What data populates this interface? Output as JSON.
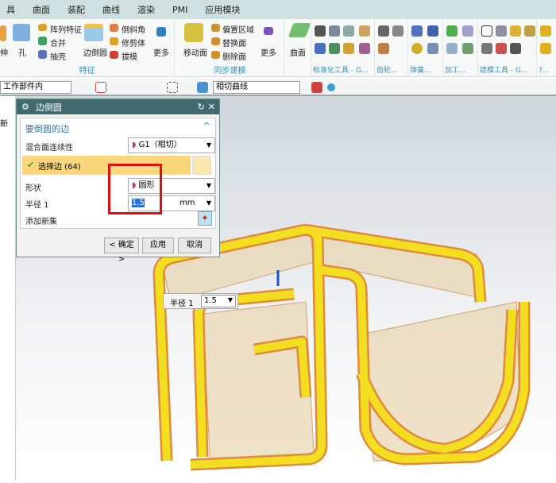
{
  "menu": [
    "具",
    "曲面",
    "装配",
    "曲线",
    "渲染",
    "PMI",
    "应用模块"
  ],
  "ribbon": {
    "feature": {
      "left_cut": "伸",
      "hole": "孔",
      "pattern": "阵列特征",
      "combine": "合并",
      "shell": "抽壳",
      "edge_blend": "边倒圆",
      "chamfer": "倒斜角",
      "trim_body": "修剪体",
      "draft": "拔模",
      "more": "更多",
      "label": "特征"
    },
    "sync": {
      "move_face": "移动面",
      "offset_region": "偏置区域",
      "replace_face": "替换面",
      "delete_face": "删除面",
      "more": "更多",
      "label": "同步建模"
    },
    "surface": {
      "label": "曲面"
    },
    "groups": [
      "标准化工具 - G...",
      "齿轮...",
      "弹簧...",
      "加工...",
      "建模工具 - G...",
      "?..."
    ]
  },
  "toolbar": {
    "scope": "工作部件内",
    "curve_rule": "相切曲线"
  },
  "left_panel": {
    "tab": "新"
  },
  "dialog": {
    "title": "边倒圆",
    "section": "要倒圆的边",
    "continuity_label": "混合面连续性",
    "continuity_value": "G1（相切）",
    "select_edge": "选择边 (64)",
    "shape_label": "形状",
    "shape_value": "圆形",
    "radius_label": "半径 1",
    "radius_value": "1.5",
    "radius_unit": "mm",
    "add_set": "添加新集",
    "ok": "< 确定 >",
    "apply": "应用",
    "cancel": "取消"
  },
  "onscreen": {
    "radius_label": "半径 1",
    "radius_value": "1.5"
  },
  "colors": {
    "dialog_title": "#3f6b70",
    "selection": "#f9d77a",
    "highlight_box": "#e01010",
    "model_edge": "#f0d010"
  }
}
